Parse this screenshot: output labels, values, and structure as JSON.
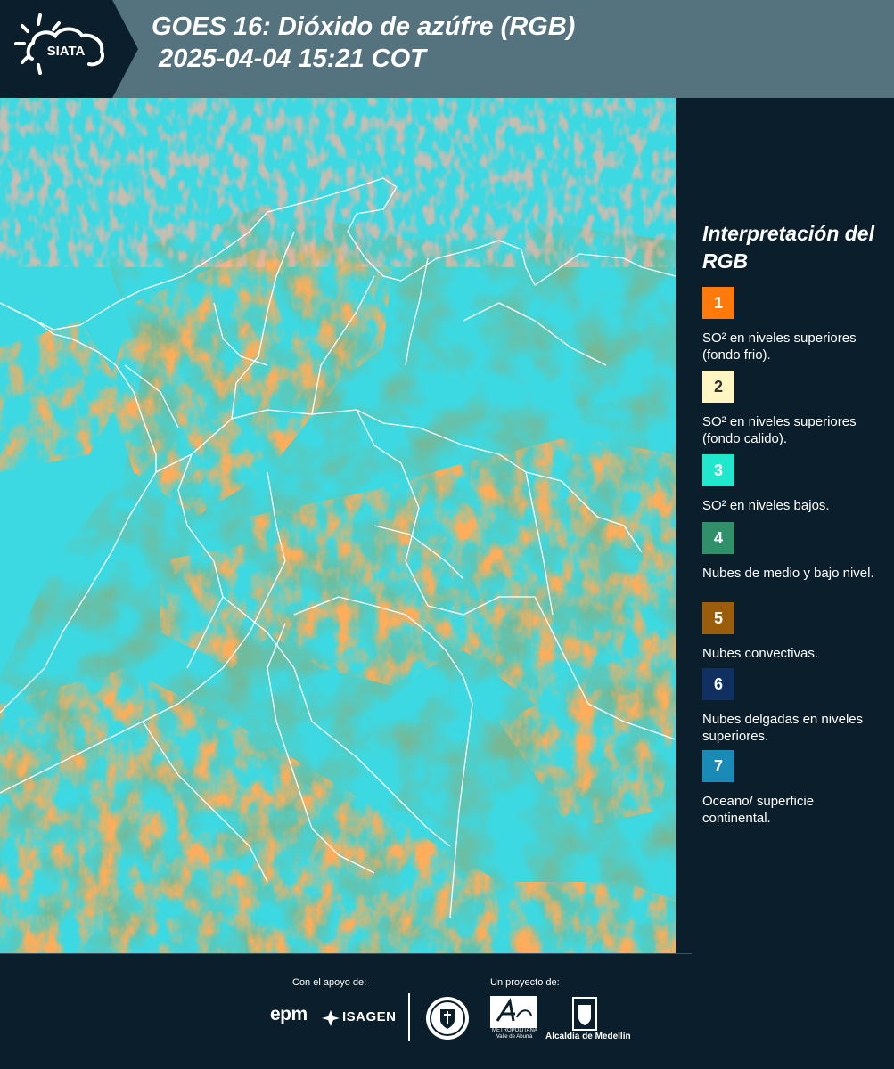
{
  "header": {
    "logo_text": "SIATA",
    "title_line1": "GOES 16: Dióxido de azúfre (RGB)",
    "title_line2": " 2025-04-04 15:21 COT",
    "background_color": "#54737f"
  },
  "map": {
    "description_colors": {
      "background_cyan": "#2ad3dd",
      "cloud_orange": "#ff6a1a",
      "cloud_green": "#2f7a4c",
      "boundary_lines": "#ffffff"
    }
  },
  "legend": {
    "title": "Interpretación del RGB",
    "items": [
      {
        "number": "1",
        "color": "#ff7a0a",
        "text": "SO² en niveles superiores (fondo frio)."
      },
      {
        "number": "2",
        "color": "#fff6c4",
        "text": "SO² en niveles superiores (fondo calido)."
      },
      {
        "number": "3",
        "color": "#21e8cc",
        "text": "SO² en niveles bajos."
      },
      {
        "number": "4",
        "color": "#2f9069",
        "text": "Nubes de medio y bajo nivel."
      },
      {
        "number": "5",
        "color": "#9a5d0c",
        "text": "Nubes convectivas."
      },
      {
        "number": "6",
        "color": "#0f3060",
        "text": "Nubes delgadas en niveles superiores."
      },
      {
        "number": "7",
        "color": "#1a8ab7",
        "text": "Oceano/ superficie continental."
      }
    ]
  },
  "footer": {
    "support_label": "Con el apoyo de:",
    "project_label": "Un proyecto de:",
    "epm": "epm",
    "isagen": "ISAGEN",
    "area_line1": "METROPOLITANA",
    "area_line2": "Valle de Aburrá",
    "alcaldia": "Alcaldía de Medellín"
  }
}
